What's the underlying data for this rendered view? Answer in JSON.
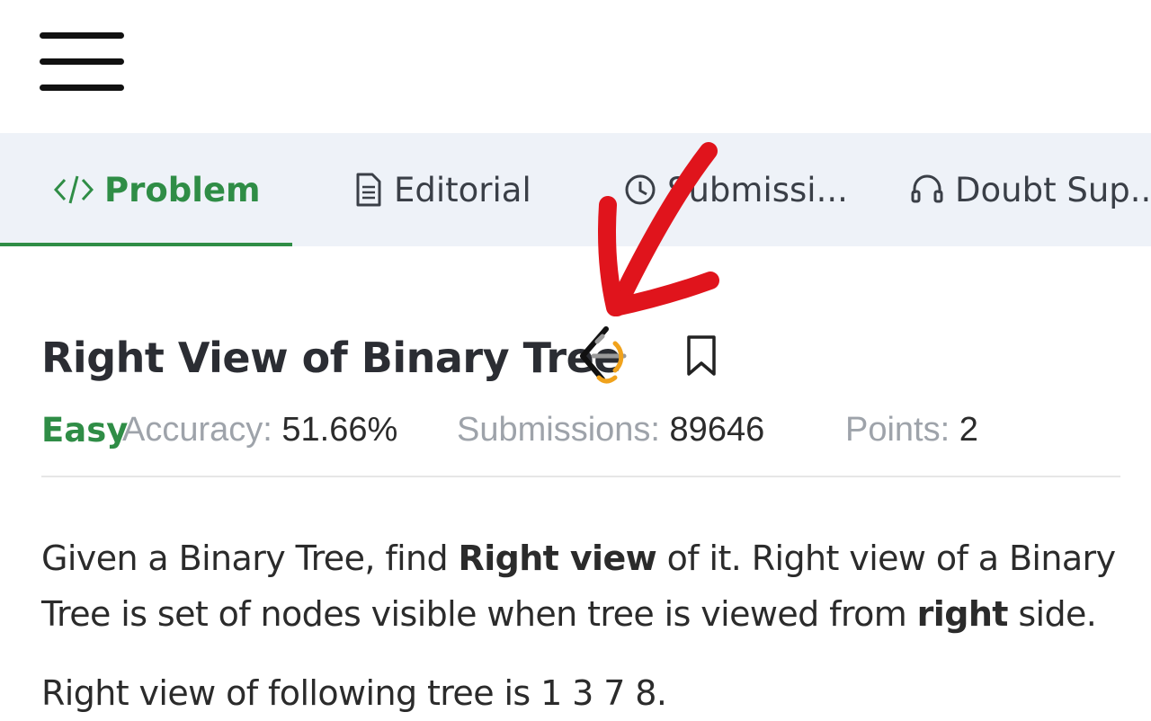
{
  "tabs": [
    {
      "label": "Problem",
      "icon": "code-icon"
    },
    {
      "label": "Editorial",
      "icon": "document-icon"
    },
    {
      "label": "Submissi...",
      "icon": "clock-icon"
    },
    {
      "label": "Doubt Sup...",
      "icon": "headset-icon"
    }
  ],
  "problem": {
    "title": "Right View of Binary Tree",
    "difficulty": "Easy",
    "accuracy_label": "Accuracy:",
    "accuracy_value": "51.66%",
    "submissions_label": "Submissions:",
    "submissions_value": "89646",
    "points_label": "Points:",
    "points_value": "2"
  },
  "description": {
    "p1_line1_a": "Given a Binary Tree, find ",
    "p1_line1_bold": "Right view",
    "p1_line1_b": " of it. Right view of a Binary",
    "p1_line2_a": "Tree is set of nodes visible when tree is viewed from ",
    "p1_line2_bold": "right",
    "p1_line2_b": " side.",
    "p2": "Right view of following tree is 1 3 7 8."
  },
  "colors": {
    "accent": "#2f8d46",
    "annotation_arrow": "#e0141c",
    "tab_bar_bg": "#eef2f8"
  }
}
